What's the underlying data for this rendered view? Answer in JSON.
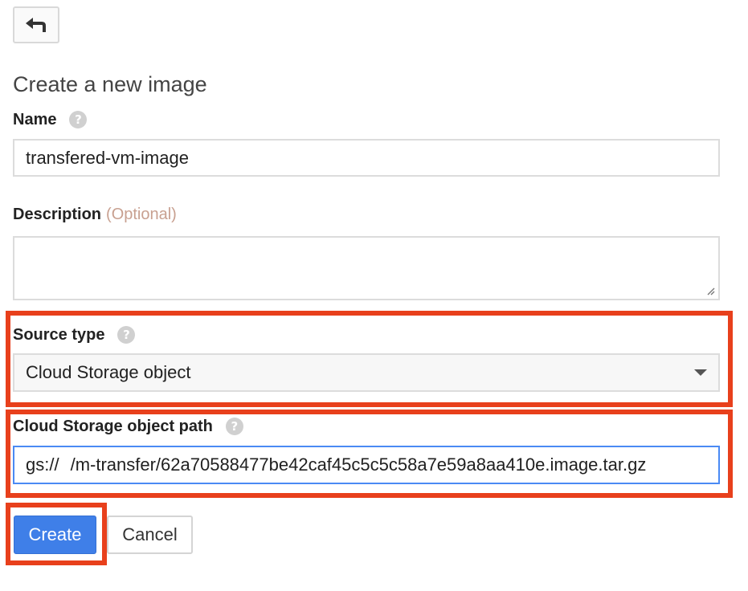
{
  "page": {
    "title": "Create a new image",
    "back_icon": "back-arrow-icon"
  },
  "form": {
    "name": {
      "label": "Name",
      "help_icon": "?",
      "value": "transfered-vm-image"
    },
    "description": {
      "label": "Description",
      "optional_label": "(Optional)",
      "value": ""
    },
    "source_type": {
      "label": "Source type",
      "help_icon": "?",
      "selected": "Cloud Storage object"
    },
    "storage_path": {
      "label": "Cloud Storage object path",
      "help_icon": "?",
      "prefix": "gs://",
      "value": "/m-transfer/62a70588477be42caf45c5c5c58a7e59a8aa410e.image.tar.gz"
    }
  },
  "actions": {
    "create_label": "Create",
    "cancel_label": "Cancel"
  },
  "colors": {
    "highlight": "#e8401c",
    "primary": "#3f7fe8",
    "focus_border": "#4a8af4"
  }
}
